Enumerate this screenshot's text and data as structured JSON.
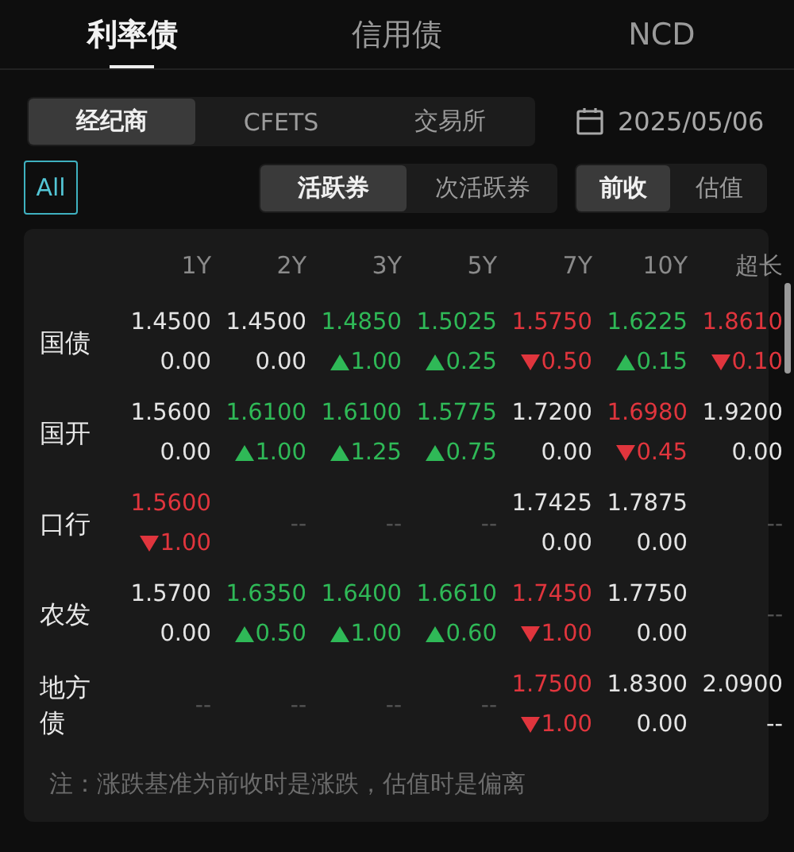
{
  "tabs": [
    {
      "label": "利率债",
      "selected": true
    },
    {
      "label": "信用债",
      "selected": false
    },
    {
      "label": "NCD",
      "selected": false
    }
  ],
  "sources": [
    {
      "label": "经纪商",
      "selected": true
    },
    {
      "label": "CFETS",
      "selected": false
    },
    {
      "label": "交易所",
      "selected": false
    }
  ],
  "date": "2025/05/06",
  "all_filter": {
    "label": "All",
    "selected": true
  },
  "bond_types": [
    {
      "label": "活跃券",
      "selected": true
    },
    {
      "label": "次活跃券",
      "selected": false
    }
  ],
  "basis": [
    {
      "label": "前收",
      "selected": true
    },
    {
      "label": "估值",
      "selected": false
    }
  ],
  "table": {
    "columns": [
      "1Y",
      "2Y",
      "3Y",
      "5Y",
      "7Y",
      "10Y",
      "超长"
    ],
    "rows": [
      {
        "label": "国债",
        "cells": [
          {
            "kind": "flat",
            "rate": "1.4500",
            "change": "0.00"
          },
          {
            "kind": "flat",
            "rate": "1.4500",
            "change": "0.00"
          },
          {
            "kind": "up",
            "rate": "1.4850",
            "change": "1.00"
          },
          {
            "kind": "up",
            "rate": "1.5025",
            "change": "0.25"
          },
          {
            "kind": "down",
            "rate": "1.5750",
            "change": "0.50"
          },
          {
            "kind": "up",
            "rate": "1.6225",
            "change": "0.15"
          },
          {
            "kind": "down",
            "rate": "1.8610",
            "change": "0.10"
          }
        ]
      },
      {
        "label": "国开",
        "cells": [
          {
            "kind": "flat",
            "rate": "1.5600",
            "change": "0.00"
          },
          {
            "kind": "up",
            "rate": "1.6100",
            "change": "1.00"
          },
          {
            "kind": "up",
            "rate": "1.6100",
            "change": "1.25"
          },
          {
            "kind": "up",
            "rate": "1.5775",
            "change": "0.75"
          },
          {
            "kind": "flat",
            "rate": "1.7200",
            "change": "0.00"
          },
          {
            "kind": "down",
            "rate": "1.6980",
            "change": "0.45"
          },
          {
            "kind": "flat",
            "rate": "1.9200",
            "change": "0.00"
          }
        ]
      },
      {
        "label": "口行",
        "cells": [
          {
            "kind": "down",
            "rate": "1.5600",
            "change": "1.00"
          },
          {
            "kind": "empty",
            "text": "--"
          },
          {
            "kind": "empty",
            "text": "--"
          },
          {
            "kind": "empty",
            "text": "--"
          },
          {
            "kind": "flat",
            "rate": "1.7425",
            "change": "0.00"
          },
          {
            "kind": "flat",
            "rate": "1.7875",
            "change": "0.00"
          },
          {
            "kind": "empty",
            "text": "--"
          }
        ]
      },
      {
        "label": "农发",
        "cells": [
          {
            "kind": "flat",
            "rate": "1.5700",
            "change": "0.00"
          },
          {
            "kind": "up",
            "rate": "1.6350",
            "change": "0.50"
          },
          {
            "kind": "up",
            "rate": "1.6400",
            "change": "1.00"
          },
          {
            "kind": "up",
            "rate": "1.6610",
            "change": "0.60"
          },
          {
            "kind": "down",
            "rate": "1.7450",
            "change": "1.00"
          },
          {
            "kind": "flat",
            "rate": "1.7750",
            "change": "0.00"
          },
          {
            "kind": "empty",
            "text": "--"
          }
        ]
      },
      {
        "label": "地方债",
        "cells": [
          {
            "kind": "empty",
            "text": "--"
          },
          {
            "kind": "empty",
            "text": "--"
          },
          {
            "kind": "empty",
            "text": "--"
          },
          {
            "kind": "empty",
            "text": "--"
          },
          {
            "kind": "down",
            "rate": "1.7500",
            "change": "1.00"
          },
          {
            "kind": "flat",
            "rate": "1.8300",
            "change": "0.00"
          },
          {
            "kind": "flat",
            "rate": "2.0900",
            "change": "--"
          }
        ]
      }
    ]
  },
  "note": "注：涨跌基准为前收时是涨跌，估值时是偏离"
}
